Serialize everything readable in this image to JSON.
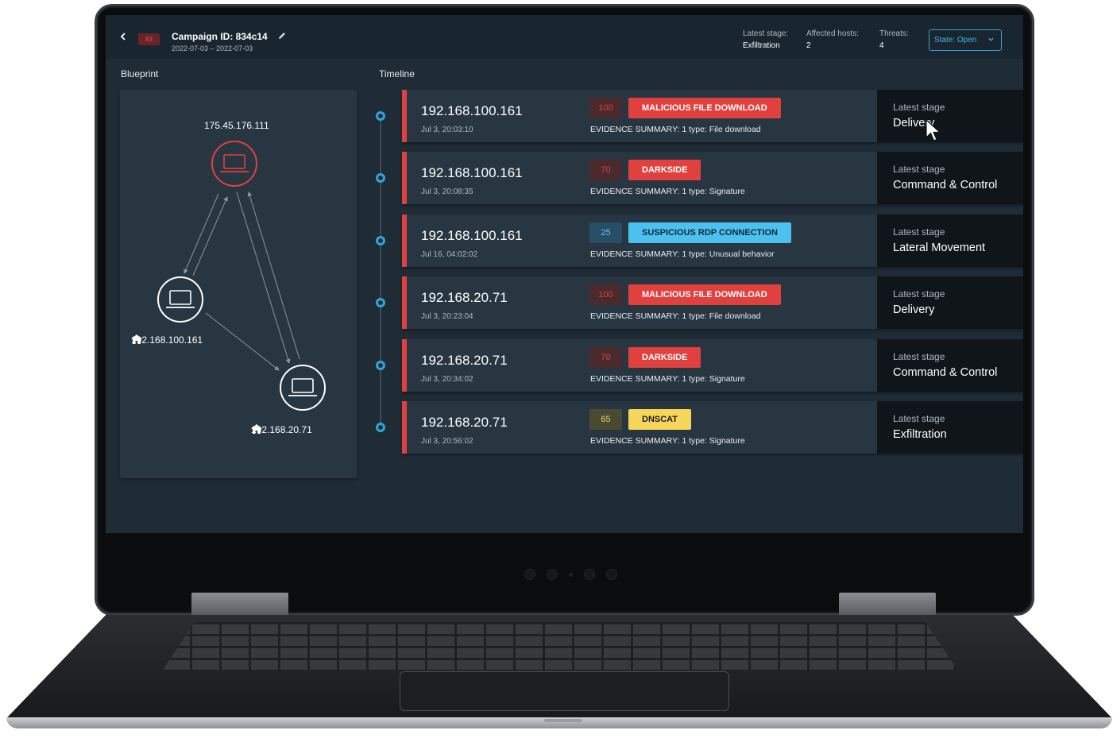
{
  "header": {
    "risk_score": "83",
    "campaign_title": "Campaign ID: 834c14",
    "date_range": "2022-07-03 – 2022-07-03",
    "latest_stage_label": "Latest stage:",
    "latest_stage_value": "Exfiltration",
    "affected_hosts_label": "Affected hosts:",
    "affected_hosts_value": "2",
    "threats_label": "Threats:",
    "threats_value": "4",
    "state_dropdown": "State: Open"
  },
  "sections": {
    "blueprint": "Blueprint",
    "timeline": "Timeline"
  },
  "blueprint": {
    "external_host": "175.45.176.111",
    "host_a": "192.168.100.161",
    "host_b": "192.168.20.71"
  },
  "stage_label": "Latest stage",
  "timeline": [
    {
      "ip": "192.168.100.161",
      "time": "Jul 3, 20:03:10",
      "score": "100",
      "threat": "MALICIOUS FILE DOWNLOAD",
      "severity": "red",
      "evidence": "EVIDENCE SUMMARY: 1 type: File download",
      "stage": "Delivery"
    },
    {
      "ip": "192.168.100.161",
      "time": "Jul 3, 20:08:35",
      "score": "70",
      "threat": "DARKSIDE",
      "severity": "red",
      "evidence": "EVIDENCE SUMMARY: 1 type: Signature",
      "stage": "Command & Control"
    },
    {
      "ip": "192.168.100.161",
      "time": "Jul 16, 04:02:02",
      "score": "25",
      "threat": "SUSPICIOUS RDP CONNECTION",
      "severity": "blue",
      "evidence": "EVIDENCE SUMMARY: 1 type: Unusual behavior",
      "stage": "Lateral Movement"
    },
    {
      "ip": "192.168.20.71",
      "time": "Jul 3, 20:23:04",
      "score": "100",
      "threat": "MALICIOUS FILE DOWNLOAD",
      "severity": "red",
      "evidence": "EVIDENCE SUMMARY: 1 type: File download",
      "stage": "Delivery"
    },
    {
      "ip": "192.168.20.71",
      "time": "Jul 3, 20:34:02",
      "score": "70",
      "threat": "DARKSIDE",
      "severity": "red",
      "evidence": "EVIDENCE SUMMARY: 1 type: Signature",
      "stage": "Command & Control"
    },
    {
      "ip": "192.168.20.71",
      "time": "Jul 3, 20:56:02",
      "score": "65",
      "threat": "DNSCAT",
      "severity": "yellow",
      "evidence": "EVIDENCE SUMMARY: 1 type: Signature",
      "stage": "Exfiltration"
    }
  ],
  "colors": {
    "accent": "#2fa4d8",
    "critical": "#e0413f",
    "info": "#4cc1f0",
    "warning": "#f5d65a"
  },
  "icons": [
    "chevron-left-icon",
    "pencil-icon",
    "chevron-down-icon",
    "laptop-icon",
    "home-icon",
    "mouse-cursor-icon"
  ]
}
